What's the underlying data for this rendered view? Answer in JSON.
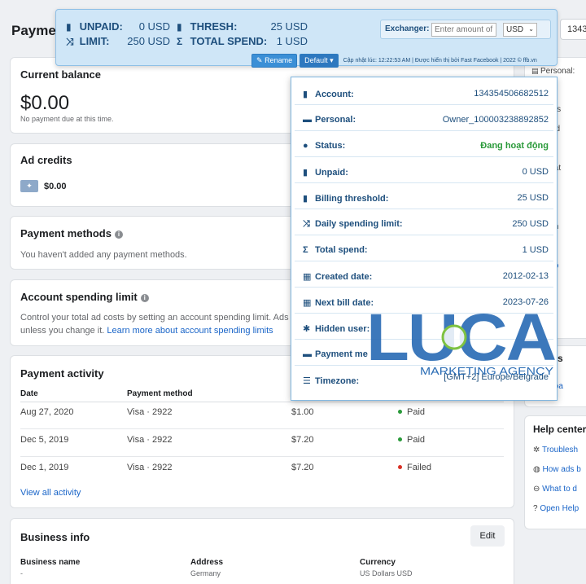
{
  "page": {
    "title": "Paymen"
  },
  "search_stub": "1343",
  "extension": {
    "unpaid_label": "UNPAID:",
    "unpaid_value": "0 USD",
    "thresh_label": "THRESH:",
    "thresh_value": "25 USD",
    "limit_label": "LIMIT:",
    "limit_value": "250 USD",
    "total_spend_label": "TOTAL SPEND:",
    "total_spend_value": "1 USD",
    "exchanger_label": "Exchanger:",
    "exchanger_placeholder": "Enter amount of",
    "currency_selected": "USD",
    "rename_label": "Rename",
    "default_label": "Default",
    "footer_note": "Cập nhật lúc: 12:22:53 AM | Được hiển thị bởi Fast Facebook | 2022 © ffb.vn"
  },
  "balance": {
    "title": "Current balance",
    "amount": "$0.00",
    "note": "No payment due at this time."
  },
  "ad_credits": {
    "title": "Ad credits",
    "amount": "$0.00"
  },
  "payment_methods": {
    "title": "Payment methods",
    "note": "You haven't added any payment methods."
  },
  "spending_limit": {
    "title": "Account spending limit",
    "line1": "Control your total ad costs by setting an account spending limit. Ads wi",
    "line2_prefix": "unless you change it.",
    "link": "Learn more about account spending limits"
  },
  "activity": {
    "title": "Payment activity",
    "headers": [
      "Date",
      "Payment method"
    ],
    "rows": [
      {
        "date": "Aug 27, 2020",
        "method": "Visa · 2922",
        "amount": "$1.00",
        "status": "Paid"
      },
      {
        "date": "Dec 5, 2019",
        "method": "Visa · 2922",
        "amount": "$7.20",
        "status": "Paid"
      },
      {
        "date": "Dec 1, 2019",
        "method": "Visa · 2922",
        "amount": "$7.20",
        "status": "Failed"
      }
    ],
    "view_all": "View all activity"
  },
  "business": {
    "title": "Business info",
    "edit_label": "Edit",
    "name_label": "Business name",
    "name_value": "-",
    "address_label": "Address",
    "address_value": "Germany",
    "currency_label": "Currency",
    "currency_value": "US Dollars USD"
  },
  "right_panel": {
    "rows": [
      "Personal:",
      "us:",
      "ng thres",
      "y spend",
      "l spend",
      "ated dat",
      "t bill da",
      "len use",
      "ment m",
      "ezone:",
      "Downlo"
    ]
  },
  "right_panel2": {
    "title": "ent his",
    "link": "Downloa"
  },
  "help_center": {
    "title": "Help center",
    "items": [
      "Troublesh",
      "How ads b",
      "What to d",
      "Open Help"
    ]
  },
  "popup": {
    "rows": [
      {
        "label": "Account:",
        "value": "134354506682512"
      },
      {
        "label": "Personal:",
        "value": "Owner_100003238892852"
      },
      {
        "label": "Status:",
        "value": "Đang hoạt động"
      },
      {
        "label": "Unpaid:",
        "value": "0 USD"
      },
      {
        "label": "Billing threshold:",
        "value": "25 USD"
      },
      {
        "label": "Daily spending limit:",
        "value": "250 USD"
      },
      {
        "label": "Total spend:",
        "value": "1 USD"
      },
      {
        "label": "Created date:",
        "value": "2012-02-13"
      },
      {
        "label": "Next bill date:",
        "value": "2023-07-26"
      },
      {
        "label": "Hidden user:",
        "value": ""
      },
      {
        "label": "Payment me",
        "value": ""
      },
      {
        "label": "Timezone:",
        "value": "[GMT+2] Europe/Belgrade"
      }
    ]
  },
  "logo": {
    "wordmark": "LUCA",
    "tagline": "MARKETING AGENCY"
  },
  "colors": {
    "accent": "#1a65c8",
    "paid": "#2a9a3a",
    "failed": "#d93025",
    "ext_text": "#1e4f7d"
  }
}
